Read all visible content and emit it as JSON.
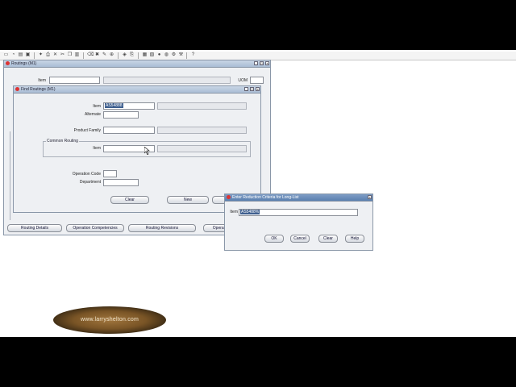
{
  "routings": {
    "title": "Routings (M1)",
    "item_label": "Item",
    "uom_label": "UOM",
    "buttons": {
      "routing_details": "Routing Details",
      "operation_competencies": "Operation Competencies",
      "routing_revisions": "Routing Revisions",
      "operation": "Operati"
    }
  },
  "find": {
    "title": "Find Routings (M1)",
    "item_label": "Item",
    "item_value": "AS54888",
    "alternate_label": "Alternate",
    "product_family_label": "Product Family",
    "common_routing_title": "Common Routing",
    "common_item_label": "Item",
    "operation_code_label": "Operation Code",
    "department_label": "Department",
    "clear_label": "Clear",
    "new_label": "New"
  },
  "dialog": {
    "title": "Enter Reduction Criteria for Long-List",
    "item_label": "Item",
    "item_value": "AS5488%",
    "ok_label": "OK",
    "cancel_label": "Cancel",
    "clear_label": "Clear",
    "help_label": "Help"
  },
  "watermark": {
    "text": "www.larryshelton.com"
  },
  "colors": {
    "selection": "#3e5f8f",
    "title_active": "#5a7fae",
    "close_dot": "#dd3333"
  }
}
